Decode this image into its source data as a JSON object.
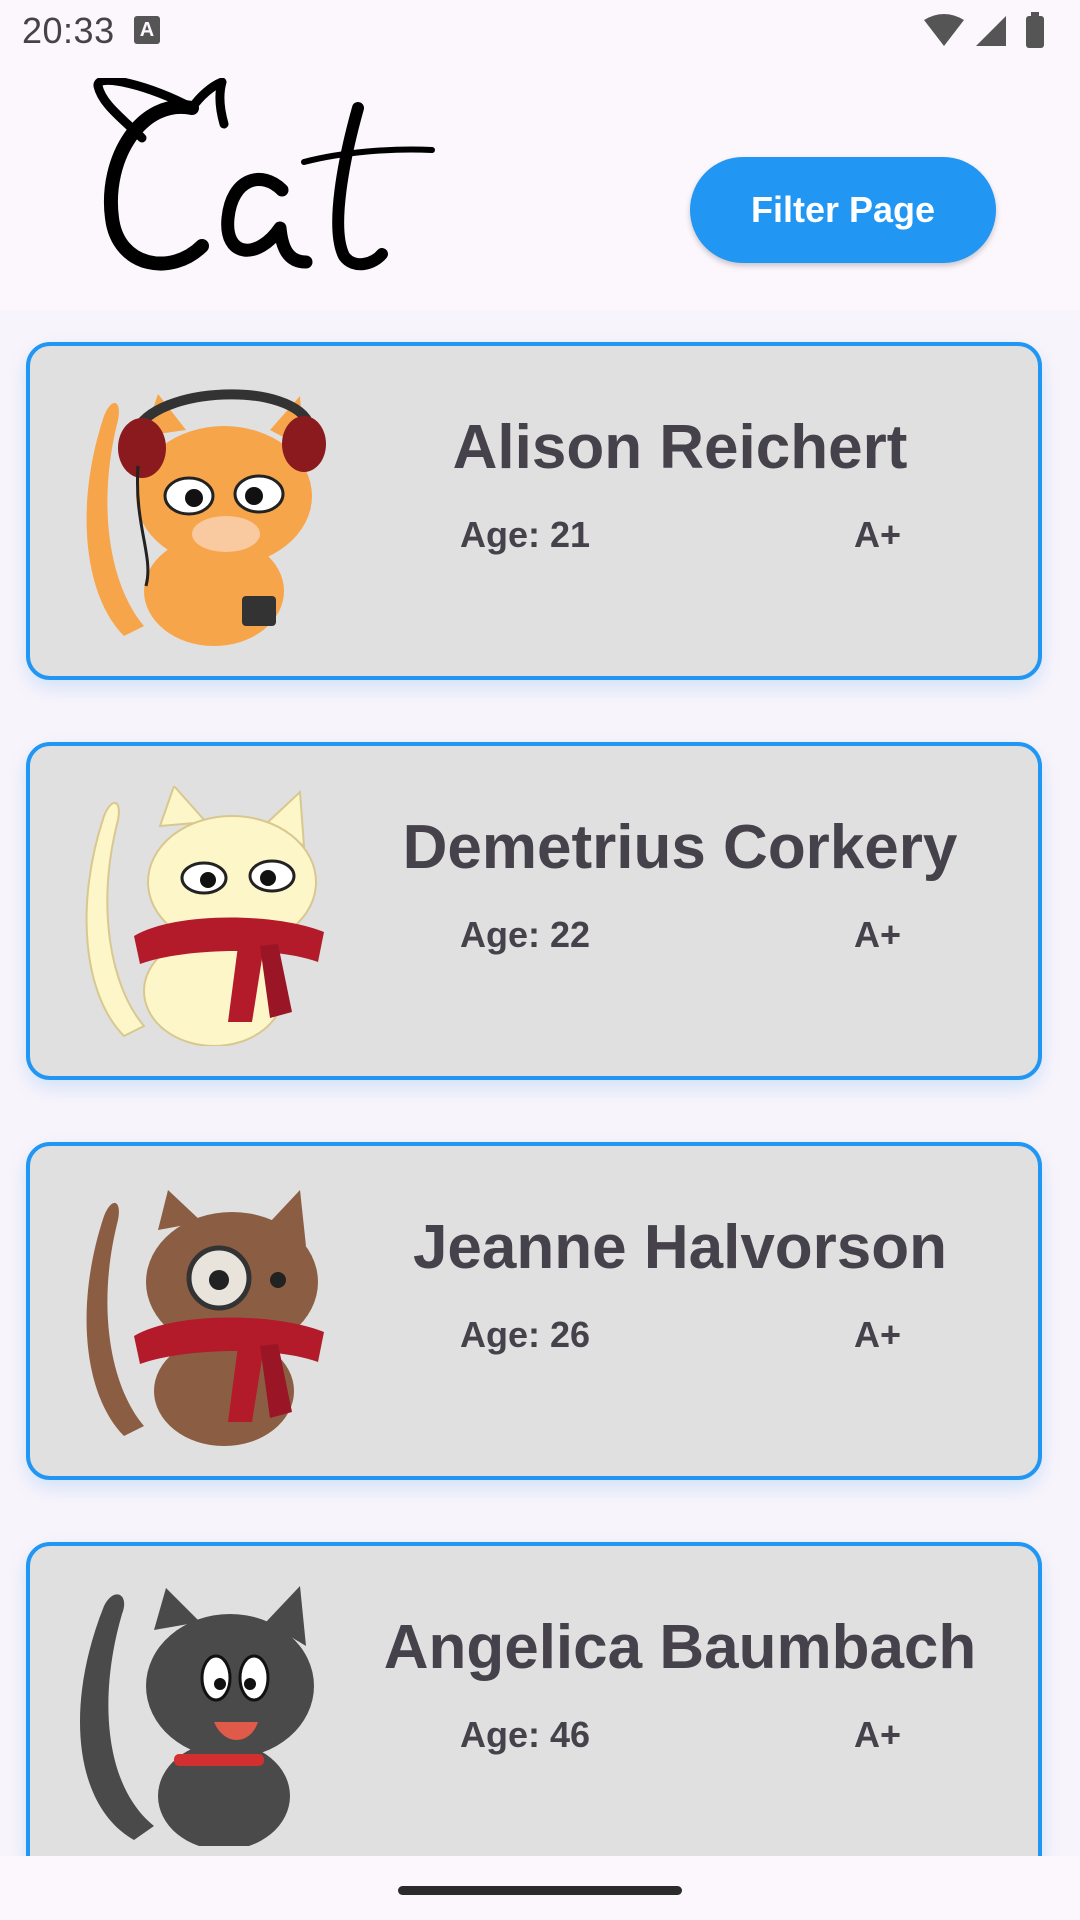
{
  "status_bar": {
    "time": "20:33",
    "notification_glyph": "A"
  },
  "header": {
    "logo_text": "Cat",
    "filter_button_label": "Filter Page"
  },
  "cats": [
    {
      "name": "Alison Reichert",
      "age": "Age: 21",
      "grade": "A+",
      "icon": "orange-cat-headphones"
    },
    {
      "name": "Demetrius Corkery",
      "age": "Age: 22",
      "grade": "A+",
      "icon": "cream-cat-scarf"
    },
    {
      "name": "Jeanne Halvorson",
      "age": "Age: 26",
      "grade": "A+",
      "icon": "brown-cat-monocle"
    },
    {
      "name": "Angelica Baumbach",
      "age": "Age: 46",
      "grade": "A+",
      "icon": "gray-cat-collar"
    }
  ],
  "colors": {
    "accent": "#2196f3",
    "card_bg": "#e0e0e0",
    "text": "#46424b",
    "page_bg": "#fcf6fd"
  }
}
